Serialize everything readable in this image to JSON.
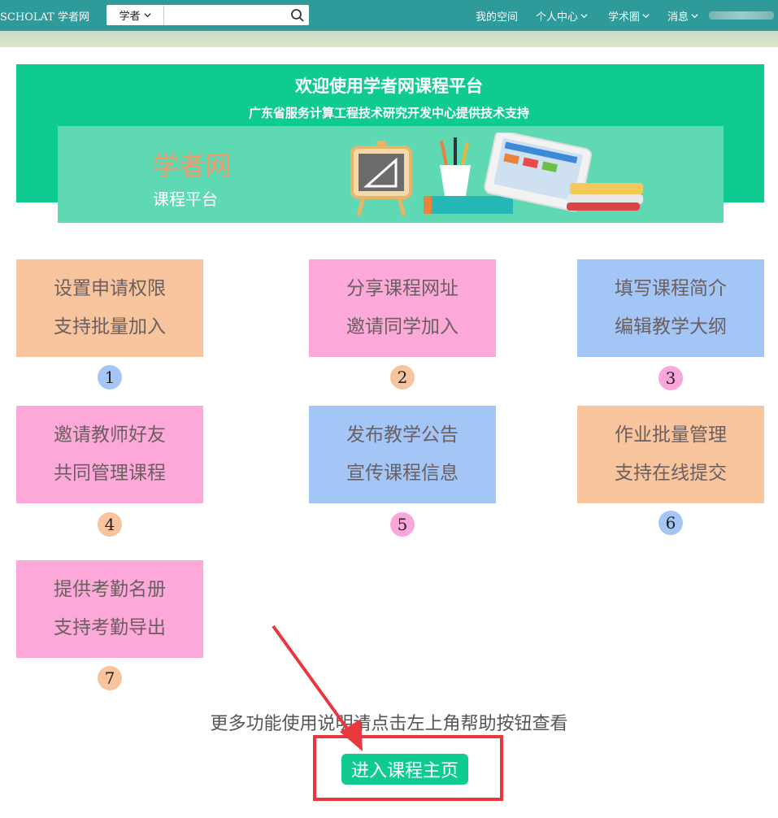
{
  "topbar": {
    "brand": "SCHOLAT 学者网",
    "search": {
      "scope": "学者",
      "value": "",
      "placeholder": ""
    },
    "nav": [
      {
        "label": "我的空间",
        "has_dropdown": false
      },
      {
        "label": "个人中心",
        "has_dropdown": true
      },
      {
        "label": "学术圈",
        "has_dropdown": true
      },
      {
        "label": "消息",
        "has_dropdown": true
      }
    ]
  },
  "banner": {
    "title": "欢迎使用学者网课程平台",
    "subtitle": "广东省服务计算工程技术研究开发中心提供技术支持",
    "logo_main": "学者网",
    "logo_sub": "课程平台"
  },
  "features": [
    {
      "line1": "设置申请权限",
      "line2": "支持批量加入",
      "number": "1",
      "card_color": "#f7c49d",
      "badge_color": "#a3c6f7"
    },
    {
      "line1": "分享课程网址",
      "line2": "邀请同学加入",
      "number": "2",
      "card_color": "#fca8d8",
      "badge_color": "#f7c49d"
    },
    {
      "line1": "填写课程简介",
      "line2": "编辑教学大纲",
      "number": "3",
      "card_color": "#a3c6f7",
      "badge_color": "#f9a6da"
    },
    {
      "line1": "邀请教师好友",
      "line2": "共同管理课程",
      "number": "4",
      "card_color": "#fca8d8",
      "badge_color": "#f7c49d"
    },
    {
      "line1": "发布教学公告",
      "line2": "宣传课程信息",
      "number": "5",
      "card_color": "#a3c6f7",
      "badge_color": "#f9a6da"
    },
    {
      "line1": "作业批量管理",
      "line2": "支持在线提交",
      "number": "6",
      "card_color": "#f7c49d",
      "badge_color": "#a3c6f7"
    },
    {
      "line1": "提供考勤名册",
      "line2": "支持考勤导出",
      "number": "7",
      "card_color": "#fca8d8",
      "badge_color": "#f7c49d"
    }
  ],
  "more_text": "更多功能使用说明请点击左上角帮助按钮查看",
  "enter_button": "进入课程主页",
  "colors": {
    "topbar": "#2e9a9a",
    "accent": "#10cb91",
    "highlight": "#e8383d"
  }
}
